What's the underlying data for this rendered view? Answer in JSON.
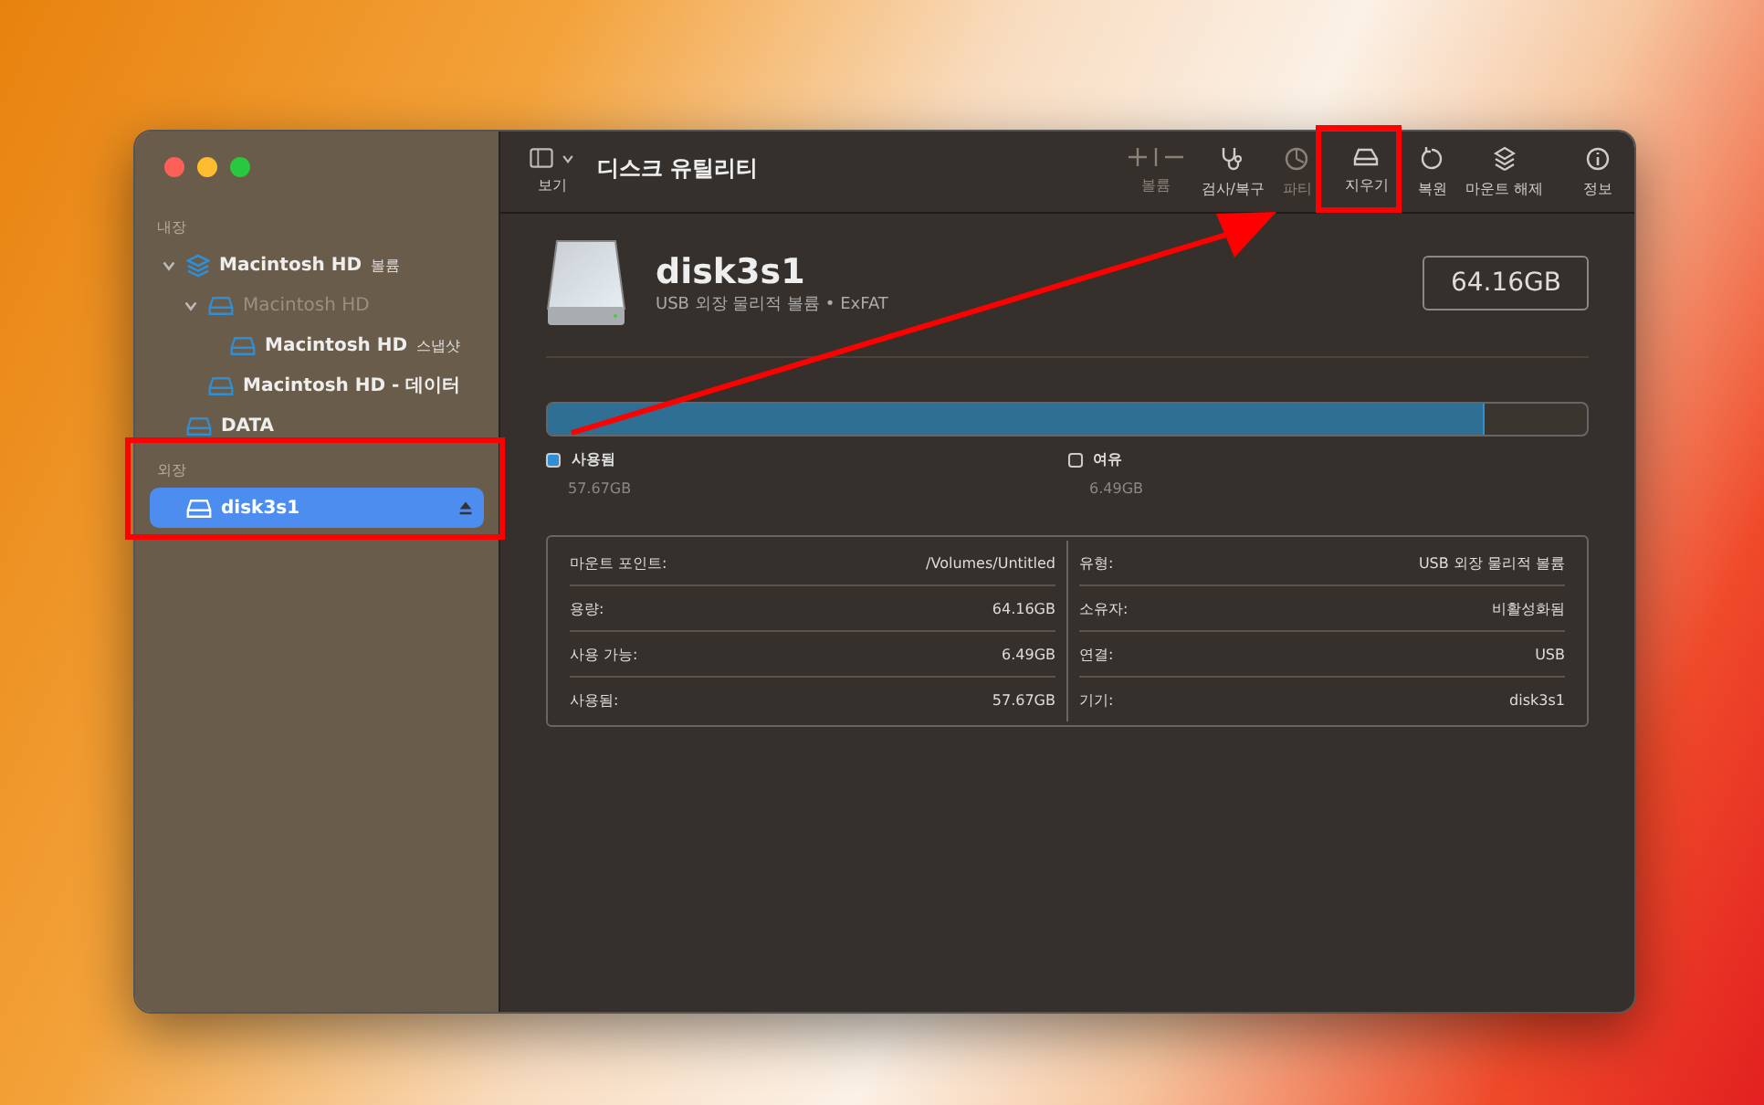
{
  "window": {
    "title": "디스크 유틸리티"
  },
  "toolbar": {
    "view_label": "보기",
    "buttons": [
      {
        "kind": "volume",
        "label": "볼륨",
        "disabled": true
      },
      {
        "kind": "firstaid",
        "label": "검사/복구",
        "disabled": false
      },
      {
        "kind": "partition",
        "label": "파티",
        "disabled": true
      },
      {
        "kind": "erase",
        "label": "지우기",
        "disabled": false
      },
      {
        "kind": "restore",
        "label": "복원",
        "disabled": false
      },
      {
        "kind": "unmount",
        "label": "마운트 해제",
        "disabled": false
      },
      {
        "kind": "info",
        "label": "정보",
        "disabled": false
      }
    ]
  },
  "sidebar": {
    "sections": [
      {
        "title": "내장",
        "items": [
          {
            "name": "Macintosh HD",
            "suffix": "볼륨",
            "kind": "stack",
            "expanded": true,
            "disabled": false,
            "selected": false,
            "children": [
              {
                "name": "Macintosh HD",
                "kind": "drive",
                "expanded": true,
                "disabled": true,
                "selected": false,
                "children": [
                  {
                    "name": "Macintosh HD",
                    "suffix": "스냅샷",
                    "kind": "drive",
                    "disabled": false,
                    "selected": false
                  }
                ]
              },
              {
                "name": "Macintosh HD - 데이터",
                "kind": "drive",
                "disabled": false,
                "selected": false
              }
            ]
          },
          {
            "name": "DATA",
            "kind": "drive",
            "disabled": false,
            "selected": false
          }
        ]
      },
      {
        "title": "외장",
        "items": [
          {
            "name": "disk3s1",
            "kind": "drive",
            "disabled": false,
            "selected": true,
            "ejectable": true
          }
        ]
      }
    ]
  },
  "volume": {
    "name": "disk3s1",
    "subtitle": "USB 외장 물리적 볼륨 • ExFAT",
    "size": "64.16GB"
  },
  "usage": {
    "level": 0.899,
    "legend": [
      {
        "label": "사용됨",
        "value": "57.67GB",
        "color": "#2f8fd6"
      },
      {
        "label": "여유",
        "value": "6.49GB",
        "color": "#3a3530"
      }
    ]
  },
  "info": {
    "left": [
      {
        "label": "마운트 포인트:",
        "value": "/Volumes/Untitled"
      },
      {
        "label": "용량:",
        "value": "64.16GB"
      },
      {
        "label": "사용 가능:",
        "value": "6.49GB"
      },
      {
        "label": "사용됨:",
        "value": "57.67GB"
      }
    ],
    "right": [
      {
        "label": "유형:",
        "value": "USB 외장 물리적 볼륨"
      },
      {
        "label": "소유자:",
        "value": "비활성화됨"
      },
      {
        "label": "연결:",
        "value": "USB"
      },
      {
        "label": "기기:",
        "value": "disk3s1"
      }
    ]
  }
}
